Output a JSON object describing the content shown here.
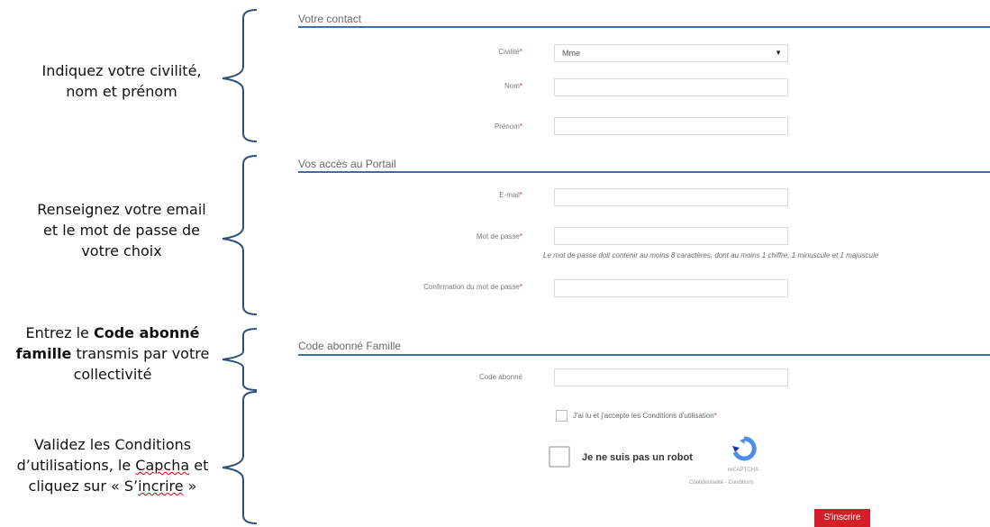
{
  "annotations": {
    "a1_line1": "Indiquez votre civilité,",
    "a1_line2": "nom et prénom",
    "a2_line1": "Renseignez votre email",
    "a2_line2": "et le mot de passe de",
    "a2_line3": "votre choix",
    "a3_pre": "Entrez le ",
    "a3_bold1": "Code abonné",
    "a3_bold2": "famille",
    "a3_mid": " transmis par votre",
    "a3_line3": "collectivité",
    "a4_line1": "Validez les Conditions",
    "a4_line2_pre": "d’utilisations, le ",
    "a4_line2_word": "Capcha",
    "a4_line2_post": " et",
    "a4_line3_pre": "cliquez sur « S’",
    "a4_line3_word": "incrire",
    "a4_line3_post": " »"
  },
  "form": {
    "section_contact": "Votre contact",
    "civilite_label": "Civilité",
    "civilite_value": "Mme",
    "nom_label": "Nom",
    "prenom_label": "Prénom",
    "section_acces": "Vos accès au Portail",
    "email_label": "E-mail",
    "password_label": "Mot de passe",
    "password_hint": "Le mot de passe doit contenir au moins 8 caractères, dont au moins 1 chiffre, 1 minuscule et 1 majuscule",
    "confirm_label": "Confirmation du mot de passe",
    "section_code": "Code abonné Famille",
    "code_label": "Code abonné",
    "cgu_label": "J'ai lu et j'accepte les Conditions d'utilisation",
    "required_mark": "*",
    "robot_label": "Je ne suis pas un robot",
    "recaptcha_brand": "reCAPTCHA",
    "recaptcha_links": "Confidentialité - Conditions",
    "submit_label": "S'inscrire"
  },
  "colors": {
    "accent_line": "#3d6fb0",
    "submit_bg": "#d41f26",
    "recaptcha_blue": "#4a90e2"
  }
}
